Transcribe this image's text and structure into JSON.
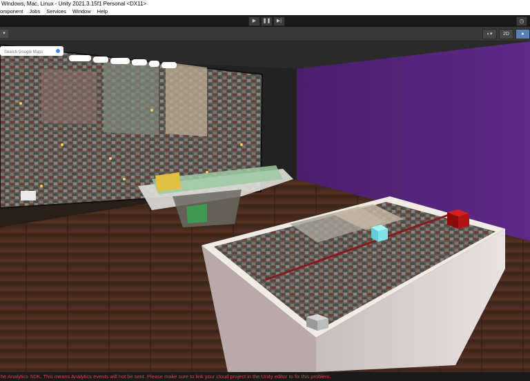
{
  "window": {
    "title": "Windows, Mac, Linux - Unity 2021.3.15f1 Personal <DX11>"
  },
  "menu": {
    "items": [
      "omponent",
      "Jobs",
      "Services",
      "Window",
      "Help"
    ]
  },
  "toolbar": {
    "play_icon": "play-icon",
    "pause_icon": "pause-icon",
    "step_icon": "step-icon",
    "history_icon": "history-icon"
  },
  "scene_toolbar": {
    "mode_2d_label": "2D"
  },
  "map_wall": {
    "search_placeholder": "Search Google Maps",
    "chips": [
      "",
      "",
      "",
      "",
      "",
      "",
      "",
      ""
    ]
  },
  "colors": {
    "purple_wall": "#5a2a80",
    "floor": "#4a2c1e",
    "error_text": "#e04040"
  },
  "console": {
    "message": "he Analytics SDK. This means Analytics events will not be sent. Please make sure to link your cloud project in the Unity editor to fix this problem."
  }
}
